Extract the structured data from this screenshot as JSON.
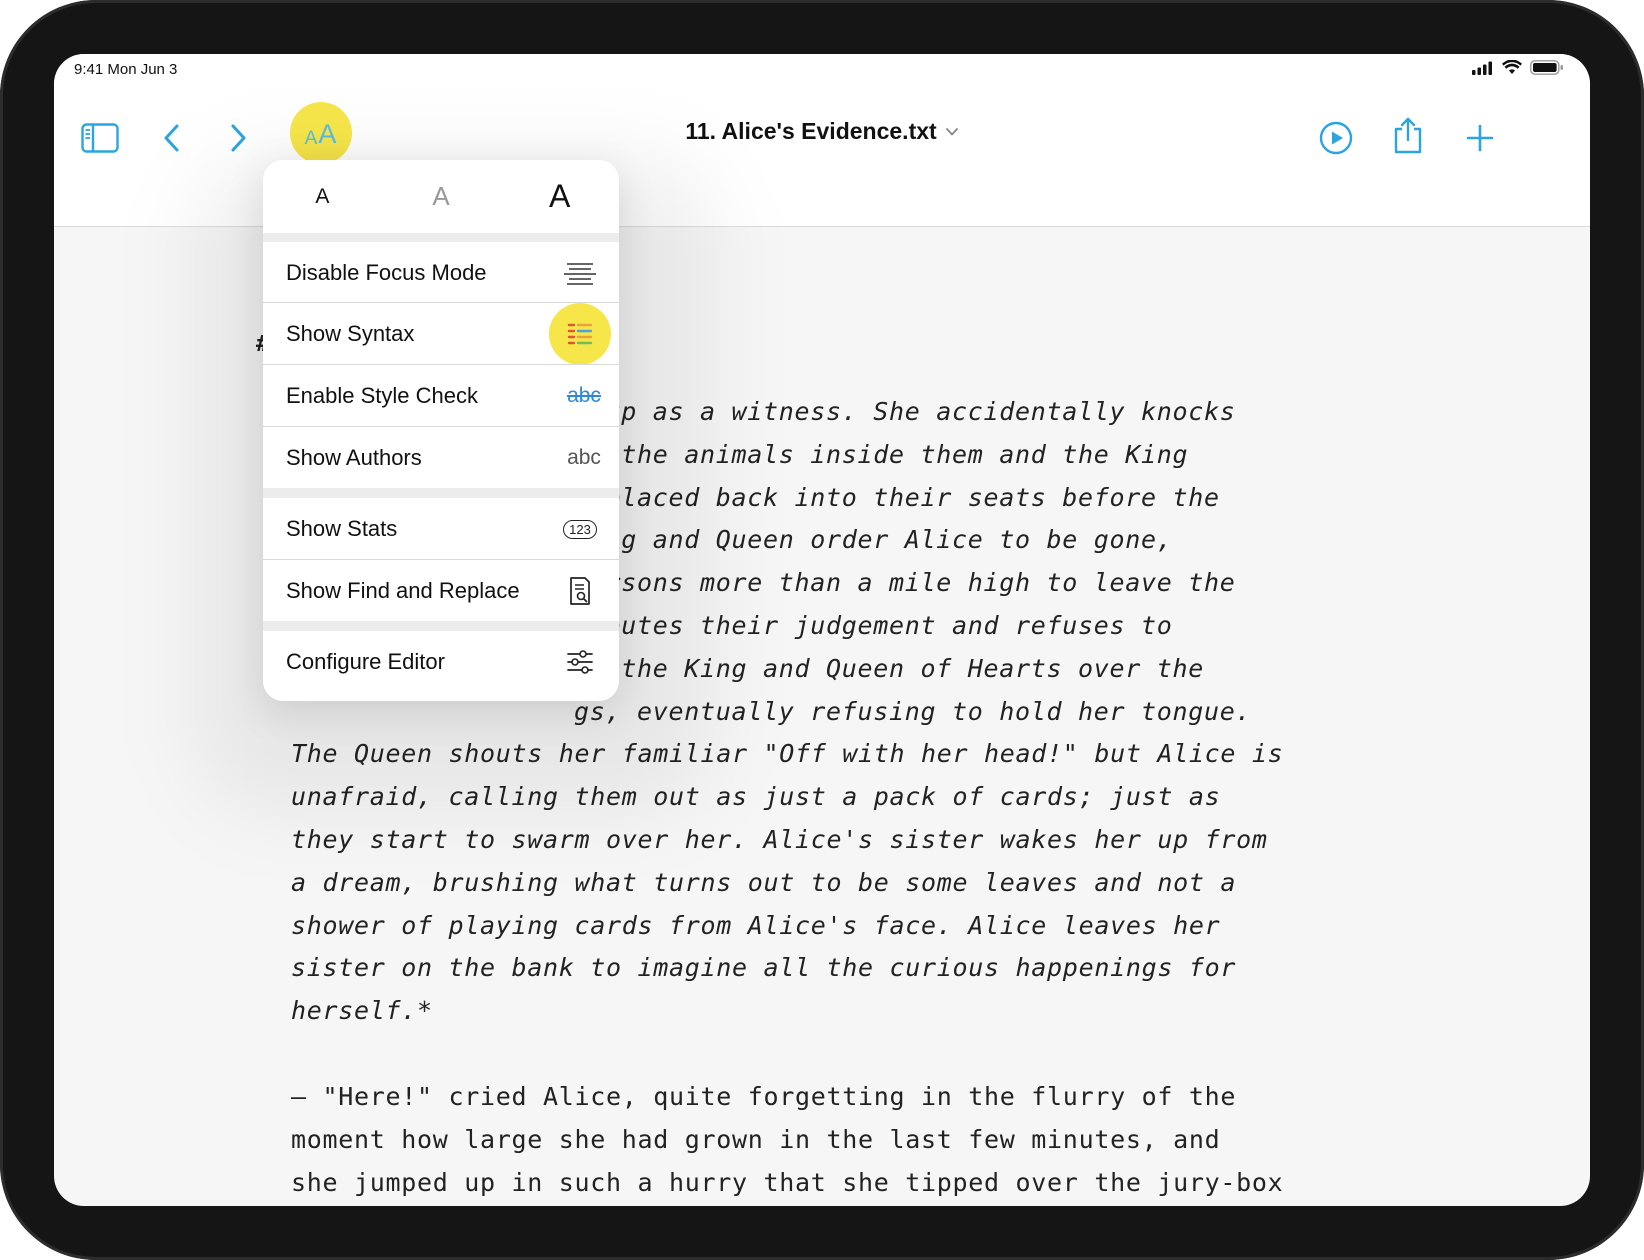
{
  "status_bar": {
    "time_date": "9:41  Mon Jun 3"
  },
  "toolbar": {
    "title": "11. Alice's Evidence.txt",
    "icons": [
      "sidebar-icon",
      "chevron-left-icon",
      "chevron-right-icon",
      "text-size-icon",
      "play-icon",
      "share-icon",
      "plus-icon"
    ],
    "aa_label_small": "A",
    "aa_label_large": "A"
  },
  "menu": {
    "sizes": [
      "A",
      "A",
      "A"
    ],
    "items": [
      {
        "label": "Disable Focus Mode",
        "icon": "focus-lines-icon"
      },
      {
        "label": "Show Syntax",
        "icon": "syntax-grid-icon"
      },
      {
        "label": "Enable Style Check",
        "icon": "strikethrough-abc-icon",
        "icon_text": "abc"
      },
      {
        "label": "Show Authors",
        "icon": "authors-abc-icon",
        "icon_text": "abc"
      },
      {
        "label": "Show Stats",
        "icon": "stats-123-icon",
        "icon_text": "123"
      },
      {
        "label": "Show Find and Replace",
        "icon": "find-document-icon"
      },
      {
        "label": "Configure Editor",
        "icon": "sliders-icon"
      }
    ]
  },
  "document": {
    "heading_mark": "#",
    "italic_lines": [
      "d up as a witness. She accidentally knocks",
      "th the animals inside them and the King",
      "e placed back into their seats before the",
      "King and Queen order Alice to be gone,",
      "persons more than a mile high to leave the",
      "isputes their judgement and refuses to",
      "th the King and Queen of Hearts over the",
      "gs, eventually refusing to hold her tongue.",
      "The Queen shouts her familiar \"Off with her head!\" but Alice is",
      "unafraid, calling them out as just a pack of cards; just as",
      "they start to swarm over her. Alice's sister wakes her up from",
      "a dream, brushing what turns out to be some leaves and not a",
      "shower of playing cards from Alice's face. Alice leaves her",
      "sister on the bank to imagine all the curious happenings for",
      "herself.*"
    ],
    "plain_lines": [
      "— \"Here!\" cried Alice, quite forgetting in the flurry of the",
      "moment how large she had grown in the last few minutes, and",
      "she jumped up in such a hurry that she tipped over the jury-box"
    ]
  }
}
